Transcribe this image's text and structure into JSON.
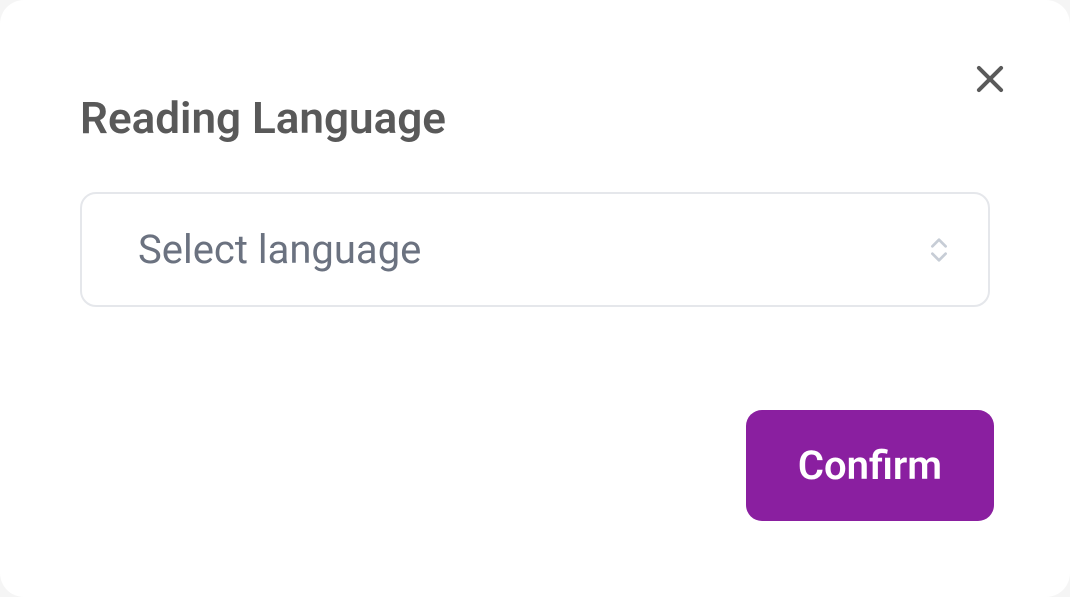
{
  "modal": {
    "title": "Reading Language",
    "select": {
      "placeholder": "Select language"
    },
    "confirm_label": "Confirm"
  },
  "colors": {
    "accent": "#8a1fa0",
    "title": "#595959",
    "placeholder": "#6b7280",
    "border": "#e5e7eb"
  }
}
